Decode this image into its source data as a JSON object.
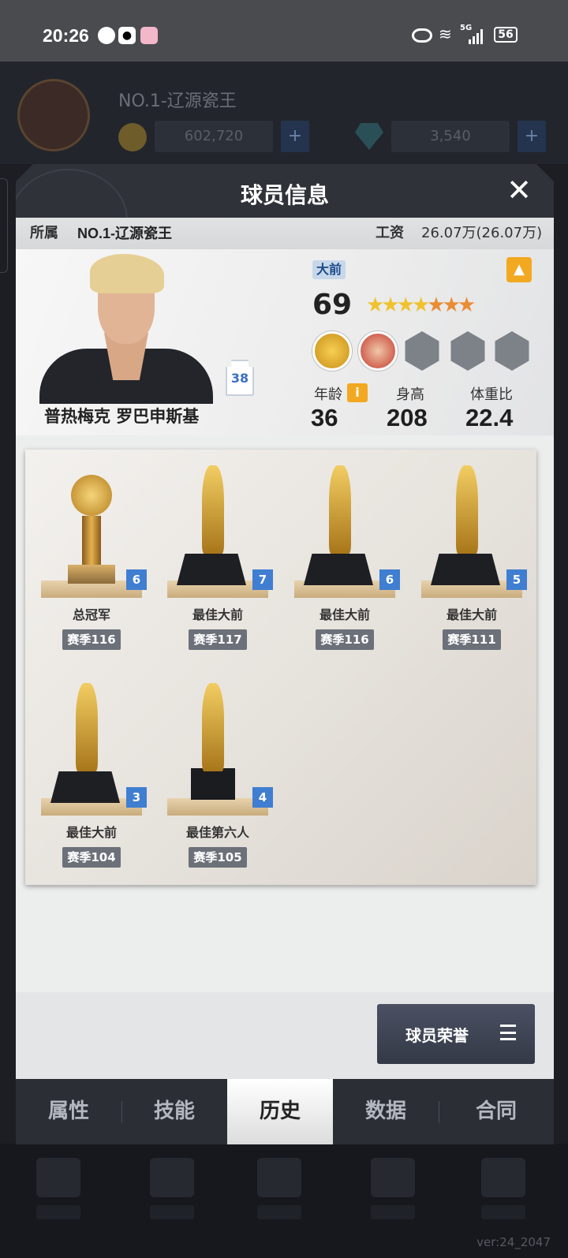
{
  "status_bar": {
    "time": "20:26",
    "network": "5G",
    "battery": "56"
  },
  "background": {
    "team_name": "NO.1-辽源瓷王",
    "coins": "602,720",
    "gems": "3,540",
    "version": "ver:24_2047"
  },
  "modal": {
    "title": "球员信息",
    "close_symbol": "✕",
    "team_label": "所属",
    "team_value": "NO.1-辽源瓷王",
    "salary_label": "工资",
    "salary_value": "26.07万(26.07万)",
    "player": {
      "name": "普热梅克 罗巴申斯基",
      "jersey_number": "38",
      "position": "大前",
      "rating": "69",
      "stars_gold": 4,
      "stars_orange": 3,
      "age_label": "年龄",
      "age_value": "36",
      "height_label": "身高",
      "height_value": "208",
      "weight_ratio_label": "体重比",
      "weight_ratio_value": "22.4",
      "info_icon": "i",
      "fire_icon": "fire-icon"
    },
    "trophies": [
      {
        "name": "总冠军",
        "count": "6",
        "season": "赛季116",
        "type": "championship-cup"
      },
      {
        "name": "最佳大前",
        "count": "7",
        "season": "赛季117",
        "type": "player-statue"
      },
      {
        "name": "最佳大前",
        "count": "6",
        "season": "赛季116",
        "type": "player-statue"
      },
      {
        "name": "最佳大前",
        "count": "5",
        "season": "赛季111",
        "type": "player-statue"
      },
      {
        "name": "最佳大前",
        "count": "3",
        "season": "赛季104",
        "type": "player-statue"
      },
      {
        "name": "最佳第六人",
        "count": "4",
        "season": "赛季105",
        "type": "sixth-man-statue"
      }
    ],
    "honor_button": "球员荣誉",
    "tabs": [
      "属性",
      "技能",
      "历史",
      "数据",
      "合同"
    ],
    "active_tab": "历史"
  }
}
